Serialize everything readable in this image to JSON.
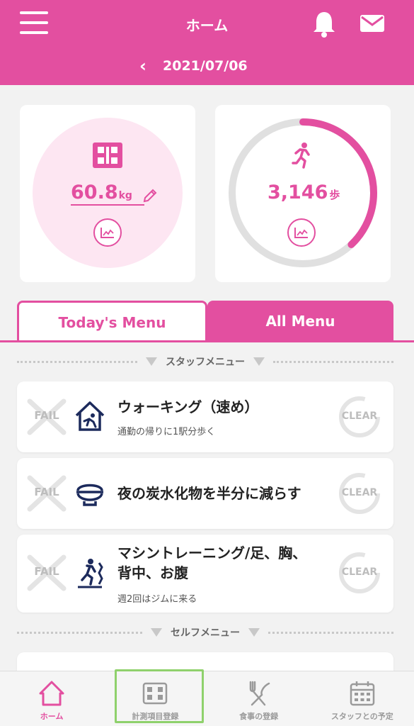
{
  "header": {
    "title": "ホーム",
    "date": "2021/07/06",
    "prev_icon": "chevron-left-icon",
    "icons": [
      "menu-icon",
      "bell-icon",
      "mail-icon"
    ]
  },
  "weight_card": {
    "value": "60.8",
    "unit": "kg",
    "icon": "scale-icon"
  },
  "steps_card": {
    "value": "3,146",
    "unit": "歩",
    "icon": "running-icon",
    "progress_fraction": 0.38
  },
  "tabs": [
    {
      "label": "Today's Menu",
      "active": false
    },
    {
      "label": "All Menu",
      "active": true
    }
  ],
  "sections": {
    "staff_menu": "スタッフメニュー",
    "self_menu": "セルフメニュー"
  },
  "menu_items": [
    {
      "title": "ウォーキング（速め）",
      "title2": "",
      "subtitle": "通勤の帰りに1駅分歩く",
      "icon": "walking-home-icon",
      "fail": "FAIL",
      "clear": "CLEAR"
    },
    {
      "title": "夜の炭水化物を半分に減らす",
      "title2": "",
      "subtitle": "",
      "icon": "rice-bowl-icon",
      "fail": "FAIL",
      "clear": "CLEAR"
    },
    {
      "title": "マシントレーニング/足、胸、",
      "title2": "背中、お腹",
      "subtitle": "週2回はジムに来る",
      "icon": "treadmill-icon",
      "fail": "FAIL",
      "clear": "CLEAR"
    }
  ],
  "bottom_nav": [
    {
      "label": "ホーム",
      "icon": "home-icon",
      "active": true
    },
    {
      "label": "計測項目登録",
      "icon": "scale-icon",
      "active": false
    },
    {
      "label": "食事の登録",
      "icon": "fork-knife-icon",
      "active": false
    },
    {
      "label": "スタッフとの予定",
      "icon": "calendar-icon",
      "active": false
    }
  ],
  "colors": {
    "brand": "#e34fa0",
    "light_pink": "#fde6f2",
    "inactive_grey": "#bdbdbd",
    "highlight_green": "#8fd16c"
  }
}
